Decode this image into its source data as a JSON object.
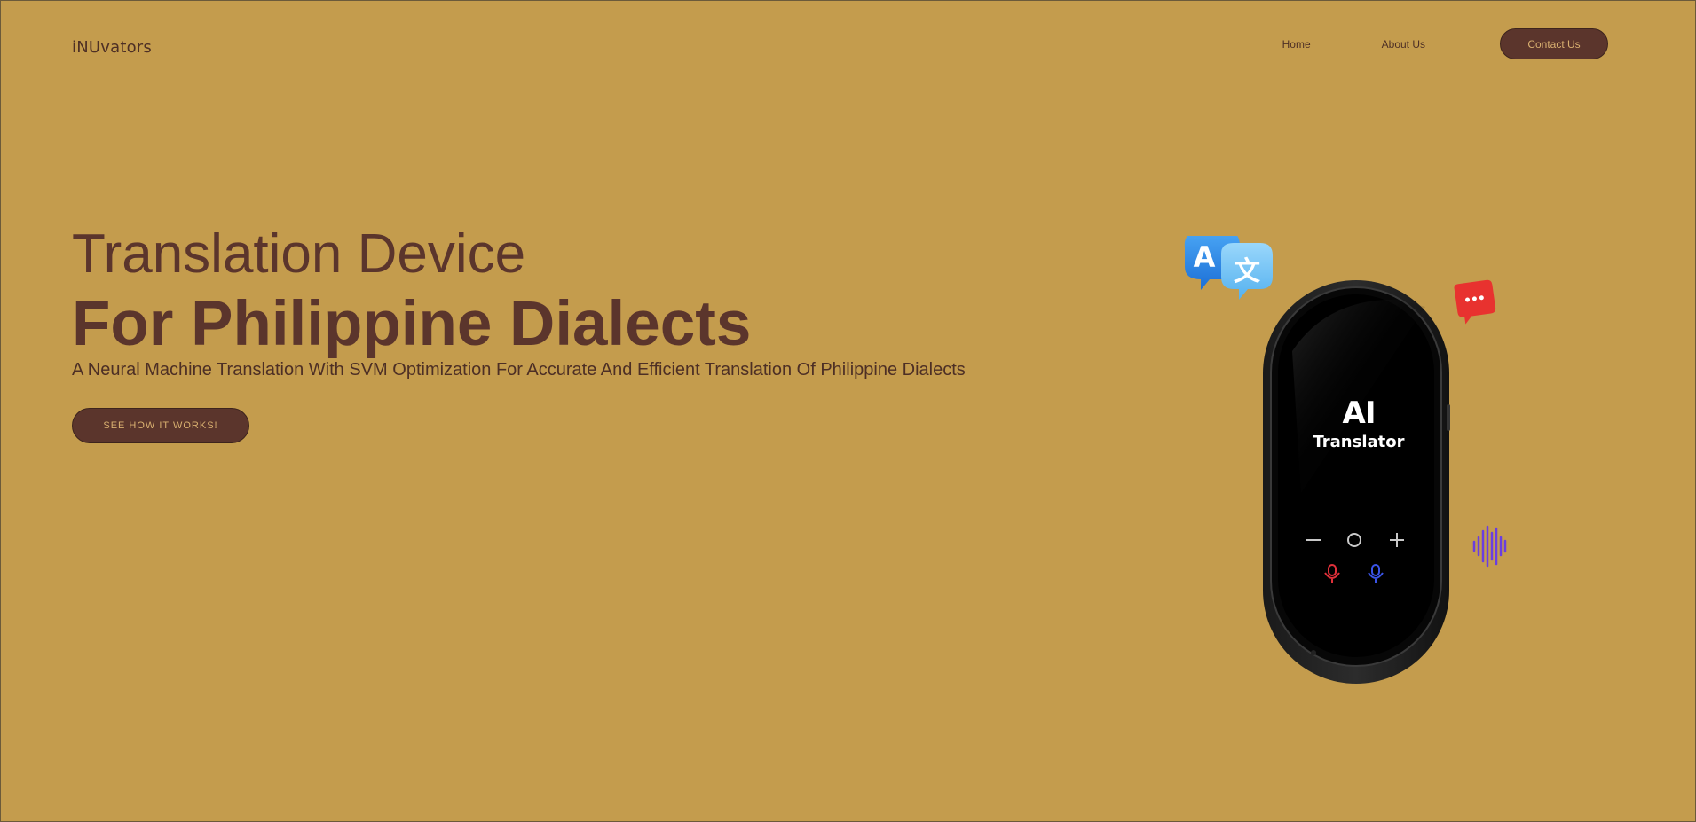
{
  "header": {
    "brand": "iNUvators",
    "nav": {
      "home": "Home",
      "about": "About Us",
      "contact": "Contact Us"
    }
  },
  "hero": {
    "title_line1": "Translation Device",
    "title_line2": "For Philippine Dialects",
    "subtitle": "A Neural Machine Translation With SVM Optimization For Accurate And Efficient Translation Of Philippine Dialects",
    "cta_label": "SEE HOW IT WORKS!"
  },
  "device": {
    "screen_line1": "AI",
    "screen_line2": "Translator",
    "icons": [
      "translate-bubble-a-icon",
      "translate-bubble-wen-icon",
      "chat-bubble-icon",
      "sound-wave-icon",
      "minus-icon",
      "circle-icon",
      "plus-icon",
      "mic-red-icon",
      "mic-blue-icon"
    ]
  },
  "colors": {
    "background": "#c49c4d",
    "primary_dark": "#5b352c",
    "button_text": "#d9b070",
    "bubble_blue": "#2a8ae8",
    "bubble_light_blue": "#6cc0f3",
    "chat_red": "#e8322f",
    "wave_purple": "#6a3ee0"
  }
}
